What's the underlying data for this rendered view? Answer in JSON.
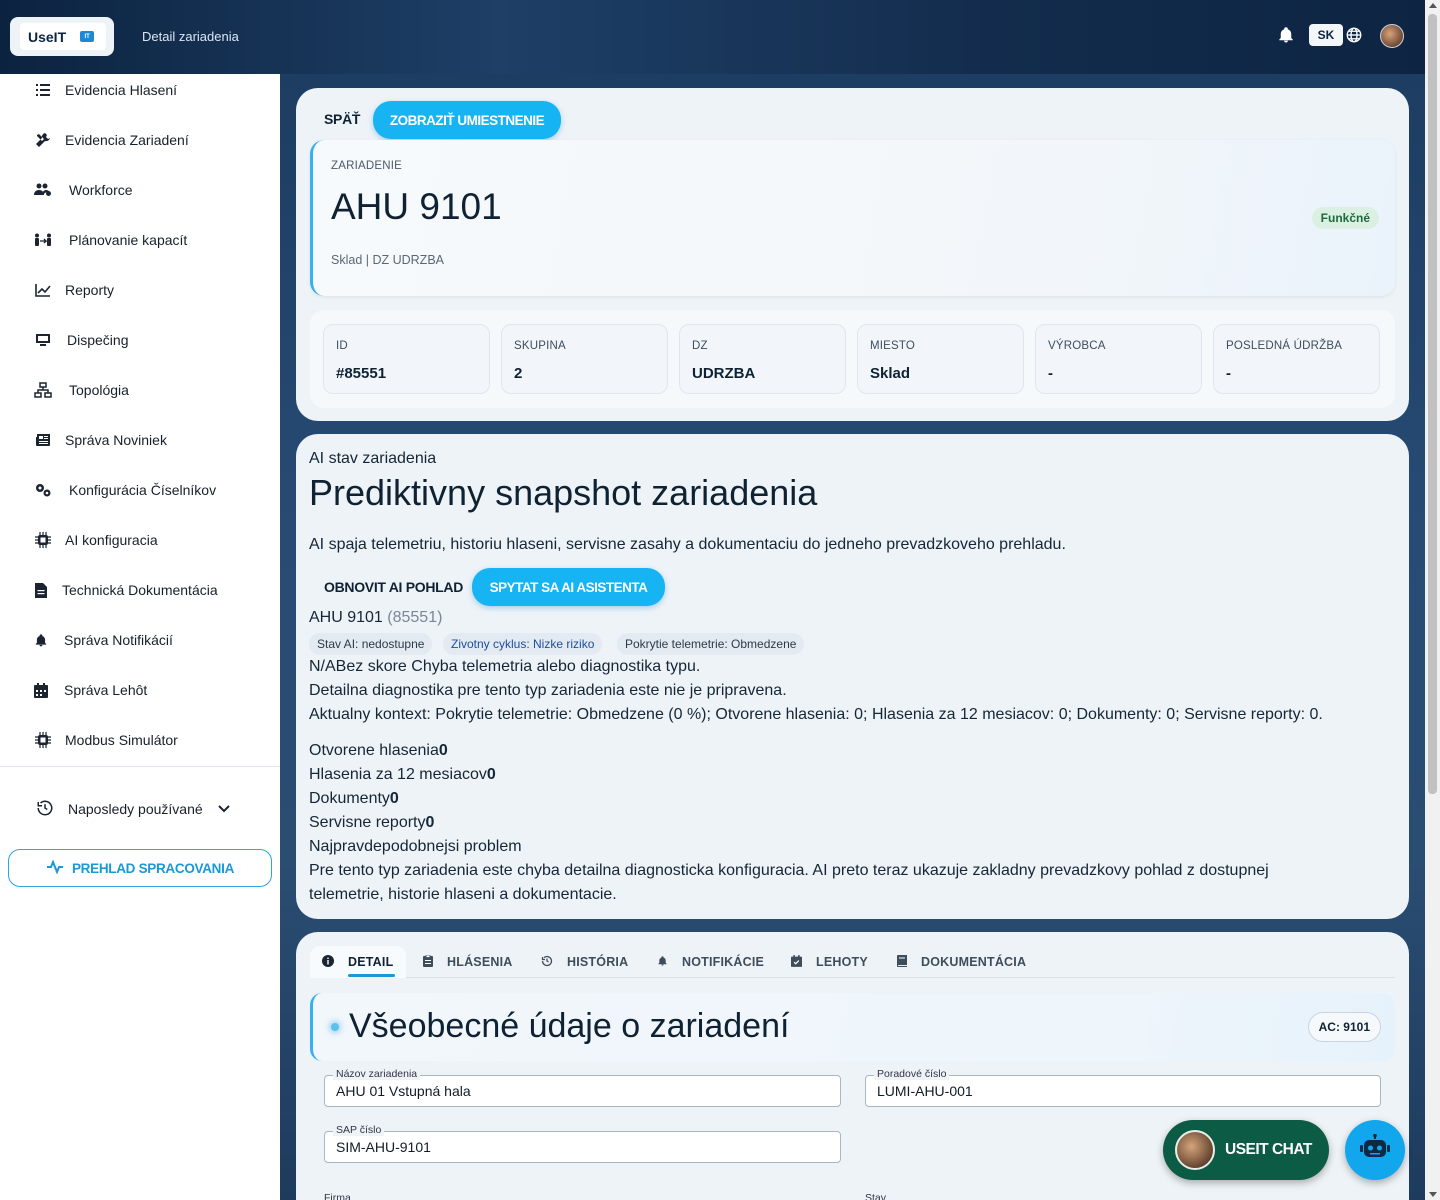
{
  "header": {
    "logo_text": "UseIT",
    "logo_badge": "IT",
    "page_title": "Detail zariadenia",
    "language": "SK"
  },
  "sidebar": {
    "items": [
      {
        "label": "Evidencia Hlasení",
        "icon": "list-icon"
      },
      {
        "label": "Evidencia Zariadení",
        "icon": "tools-icon"
      },
      {
        "label": "Workforce",
        "icon": "users-gear-icon"
      },
      {
        "label": "Plánovanie kapacít",
        "icon": "people-arrows-icon"
      },
      {
        "label": "Reporty",
        "icon": "chart-line-icon"
      },
      {
        "label": "Dispečing",
        "icon": "monitor-icon"
      },
      {
        "label": "Topológia",
        "icon": "sitemap-icon"
      },
      {
        "label": "Správa Noviniek",
        "icon": "newspaper-icon"
      },
      {
        "label": "Konfigurácia Číselníkov",
        "icon": "gears-icon"
      },
      {
        "label": "AI konfiguracia",
        "icon": "chip-icon"
      },
      {
        "label": "Technická Dokumentácia",
        "icon": "document-icon"
      },
      {
        "label": "Správa Notifikácií",
        "icon": "bell-icon"
      },
      {
        "label": "Správa Lehôt",
        "icon": "calendar-icon"
      },
      {
        "label": "Modbus Simulátor",
        "icon": "chip-icon"
      }
    ],
    "recent_label": "Naposledy používané",
    "prehlad_label": "PREHLAD SPRACOVANIA"
  },
  "top_card": {
    "back_label": "SPÄŤ",
    "show_location_label": "ZOBRAZIŤ UMIESTNENIE",
    "hero_label": "ZARIADENIE",
    "device_name": "AHU 9101",
    "device_sub": "Sklad | DZ UDRZBA",
    "status": "Funkčné",
    "status_color": "#1d6b3c",
    "info": [
      {
        "key": "ID",
        "value": "#85551"
      },
      {
        "key": "SKUPINA",
        "value": "2"
      },
      {
        "key": "DZ",
        "value": "UDRZBA"
      },
      {
        "key": "MIESTO",
        "value": "Sklad"
      },
      {
        "key": "VÝROBCA",
        "value": "-"
      },
      {
        "key": "POSLEDNÁ ÚDRŽBA",
        "value": "-"
      }
    ]
  },
  "ai_card": {
    "small_title": "AI stav zariadenia",
    "title": "Prediktivny snapshot zariadenia",
    "description": "AI spaja telemetriu, historiu hlaseni, servisne zasahy a dokumentaciu do jedneho prevadzkoveho prehladu.",
    "refresh_label": "OBNOVIT AI POHLAD",
    "ask_label": "SPYTAT SA AI ASISTENTA",
    "device_name": "AHU 9101",
    "device_id": "(85551)",
    "chips": [
      "Stav AI: nedostupne",
      "Zivotny cyklus: Nizke riziko",
      "Pokrytie telemetrie: Obmedzene"
    ],
    "score_line": "N/ABez skore Chyba telemetria alebo diagnostika typu.",
    "detail_line": "Detailna diagnostika pre tento typ zariadenia este nie je pripravena.",
    "context_line": "Aktualny kontext: Pokrytie telemetrie: Obmedzene (0 %); Otvorene hlasenia: 0; Hlasenia za 12 mesiacov: 0; Dokumenty: 0; Servisne reporty: 0.",
    "stats": [
      {
        "label": "Otvorene hlasenia",
        "value": "0"
      },
      {
        "label": "Hlasenia za 12 mesiacov",
        "value": "0"
      },
      {
        "label": "Dokumenty",
        "value": "0"
      },
      {
        "label": "Servisne reporty",
        "value": "0"
      }
    ],
    "problem_label": "Najpravdepodobnejsi problem",
    "problem_text_1": "Pre tento typ zariadenia este chyba detailna diagnosticka konfiguracia. AI preto teraz ukazuje zakladny prevadzkovy pohlad z dostupnej",
    "problem_text_2": "telemetrie, historie hlaseni a dokumentacie."
  },
  "detail_card": {
    "tabs": [
      {
        "label": "DETAIL",
        "icon": "info-icon"
      },
      {
        "label": "HLÁSENIA",
        "icon": "clipboard-icon"
      },
      {
        "label": "HISTÓRIA",
        "icon": "history-icon"
      },
      {
        "label": "NOTIFIKÁCIE",
        "icon": "bell-icon"
      },
      {
        "label": "LEHOTY",
        "icon": "calendar-check-icon"
      },
      {
        "label": "DOKUMENTÁCIA",
        "icon": "book-icon"
      }
    ],
    "section_title": "Všeobecné údaje o zariadení",
    "ac_label": "AC: 9101",
    "fields": {
      "name": {
        "label": "Názov zariadenia",
        "value": "AHU 01 Vstupná hala"
      },
      "serial": {
        "label": "Poradové číslo",
        "value": "LUMI-AHU-001"
      },
      "sap": {
        "label": "SAP číslo",
        "value": "SIM-AHU-9101"
      },
      "firma": {
        "label": "Firma"
      },
      "stav": {
        "label": "Stav"
      }
    }
  },
  "floating": {
    "chat_label": "USEIT CHAT"
  },
  "colors": {
    "accent": "#16b4f2",
    "chat_green": "#0c5b45",
    "navy": "#0f2233"
  }
}
